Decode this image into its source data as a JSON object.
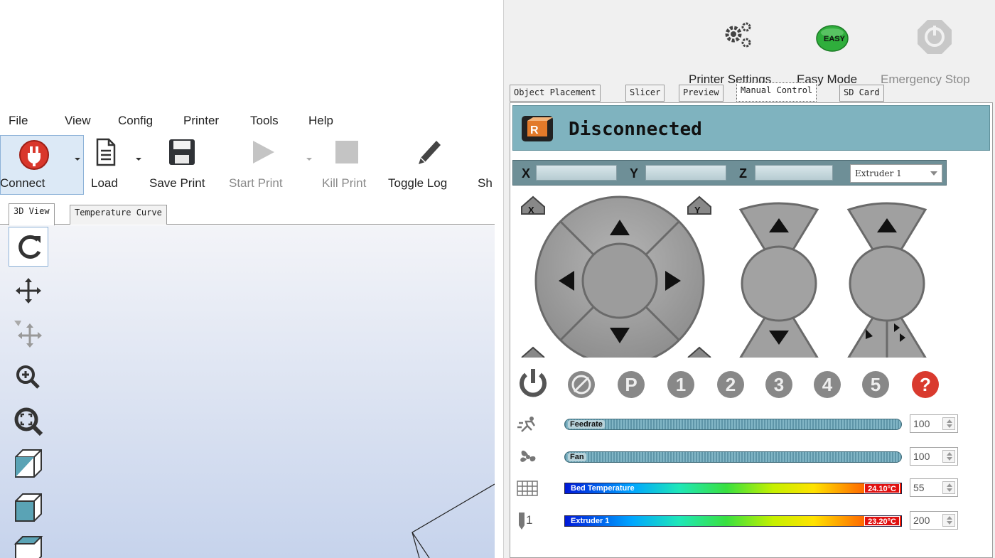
{
  "left_window": {
    "menu": [
      "File",
      "View",
      "Config",
      "Printer",
      "Tools",
      "Help"
    ],
    "toolbar": {
      "connect": "Connect",
      "load": "Load",
      "save_print": "Save Print",
      "start_print": "Start Print",
      "kill_print": "Kill Print",
      "toggle_log": "Toggle Log",
      "overflow": "Sh"
    },
    "tabs": [
      "3D View",
      "Temperature Curve"
    ],
    "side_tools": [
      "refresh-icon",
      "move-icon",
      "move-object-icon",
      "zoom-in-icon",
      "fit-view-icon",
      "view-iso-icon",
      "view-front-icon",
      "view-top-icon"
    ]
  },
  "right_window": {
    "toolbar": {
      "printer_settings": "Printer Settings",
      "easy_mode": "Easy Mode",
      "easy_badge": "EASY",
      "emergency_stop": "Emergency Stop"
    },
    "tabs": [
      "Object Placement",
      "Slicer",
      "Preview",
      "Manual Control",
      "SD Card"
    ],
    "active_tab": "Manual Control",
    "status": "Disconnected",
    "axes": {
      "x": "X",
      "y": "Y",
      "z": "Z"
    },
    "extruder_select": "Extruder 1",
    "function_buttons": [
      "power-icon",
      "fan-off-icon",
      "P",
      "1",
      "2",
      "3",
      "4",
      "5",
      "help-icon"
    ],
    "sliders": {
      "feedrate": {
        "label": "Feedrate",
        "value": "100"
      },
      "fan": {
        "label": "Fan",
        "value": "100"
      },
      "bed": {
        "label": "Bed Temperature",
        "reading": "24.10°C",
        "target": "55"
      },
      "extruder": {
        "label": "Extruder 1",
        "icon_number": "1",
        "reading": "23.20°C",
        "target": "200"
      }
    },
    "colors": {
      "status_bar": "#7fb3bf",
      "stop_red": "#d93a2e",
      "easy_green": "#2fae3c"
    }
  }
}
